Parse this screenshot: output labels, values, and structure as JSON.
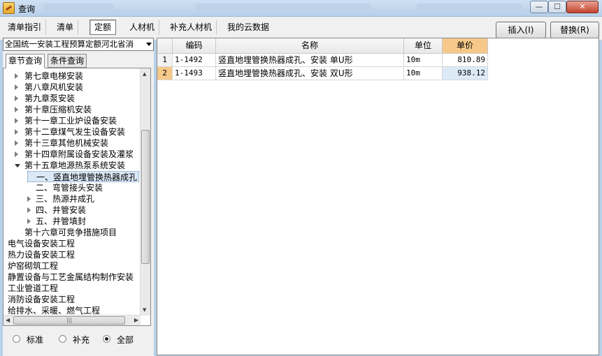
{
  "window": {
    "title": "查询"
  },
  "toolbar": {
    "tabs": [
      "清单指引",
      "清单",
      "定额",
      "人材机",
      "补充人材机",
      "我的云数据"
    ],
    "active_tab": "定额",
    "insert_label": "插入(I)",
    "replace_label": "替换(R)"
  },
  "left": {
    "library_combo": "全国统一安装工程预算定额河北省消",
    "tabs": [
      "章节查询",
      "条件查询"
    ],
    "tree": [
      {
        "label": "第七章电梯安装"
      },
      {
        "label": "第八章风机安装"
      },
      {
        "label": "第九章泵安装"
      },
      {
        "label": "第十章压缩机安装"
      },
      {
        "label": "第十一章工业炉设备安装"
      },
      {
        "label": "第十二章煤气发生设备安装"
      },
      {
        "label": "第十三章其他机械安装"
      },
      {
        "label": "第十四章附属设备安装及灌浆"
      },
      {
        "label": "第十五章地源热泵系统安装"
      },
      {
        "label": "一、竖直地埋管换热器成孔"
      },
      {
        "label": "二、弯管接头安装"
      },
      {
        "label": "三、热源井成孔"
      },
      {
        "label": "四、井管安装"
      },
      {
        "label": "五、井管填封"
      },
      {
        "label": "第十六章可竞争措施项目"
      },
      {
        "label": "电气设备安装工程"
      },
      {
        "label": "热力设备安装工程"
      },
      {
        "label": "炉窑砌筑工程"
      },
      {
        "label": "静置设备与工艺金属结构制作安装"
      },
      {
        "label": "工业管道工程"
      },
      {
        "label": "消防设备安装工程"
      },
      {
        "label": "给排水、采暖、燃气工程"
      }
    ],
    "radios": [
      "标准",
      "补充",
      "全部"
    ],
    "radio_selected": "全部"
  },
  "grid": {
    "headers": [
      "编码",
      "名称",
      "单位",
      "单价"
    ],
    "rows": [
      {
        "no": "1",
        "code": "1-1492",
        "name": "竖直地埋管换热器成孔、安装 单U形",
        "unit": "10m",
        "price": "810.89"
      },
      {
        "no": "2",
        "code": "1-1493",
        "name": "竖直地埋管换热器成孔、安装 双U形",
        "unit": "10m",
        "price": "938.12"
      }
    ]
  }
}
